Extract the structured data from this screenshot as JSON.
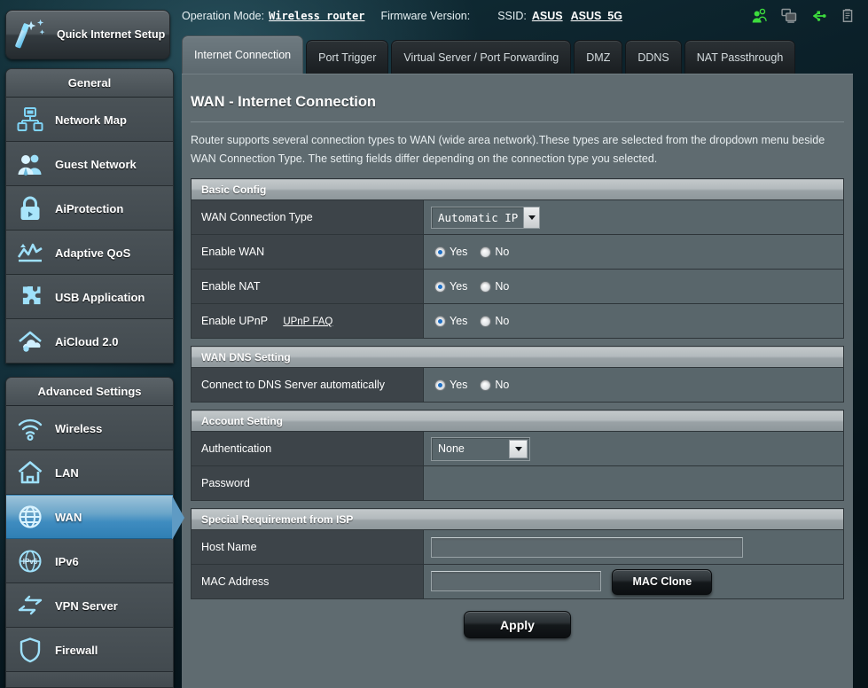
{
  "topbar": {
    "operation_mode_label": "Operation Mode:",
    "operation_mode_value": "Wireless router",
    "firmware_label": "Firmware Version:",
    "firmware_value": "",
    "ssid_label": "SSID:",
    "ssid_1": "ASUS",
    "ssid_2": "ASUS_5G",
    "icons": [
      {
        "name": "clients-icon",
        "color": "#3ddc3d"
      },
      {
        "name": "devices-icon",
        "color": "#8d9598"
      },
      {
        "name": "usb-icon",
        "color": "#3ddc3d"
      },
      {
        "name": "printer-icon",
        "color": "#8d9598"
      }
    ]
  },
  "sidebar": {
    "quick_setup": {
      "label": "Quick Internet Setup",
      "icon": "magic-wand-icon"
    },
    "general": {
      "header": "General",
      "items": [
        {
          "label": "Network Map",
          "icon": "network-map-icon"
        },
        {
          "label": "Guest Network",
          "icon": "guest-network-icon"
        },
        {
          "label": "AiProtection",
          "icon": "lock-icon"
        },
        {
          "label": "Adaptive QoS",
          "icon": "qos-chart-icon"
        },
        {
          "label": "USB Application",
          "icon": "puzzle-icon"
        },
        {
          "label": "AiCloud 2.0",
          "icon": "cloud-house-icon"
        }
      ]
    },
    "advanced": {
      "header": "Advanced Settings",
      "items": [
        {
          "label": "Wireless",
          "icon": "wifi-icon",
          "active": false
        },
        {
          "label": "LAN",
          "icon": "house-icon",
          "active": false
        },
        {
          "label": "WAN",
          "icon": "globe-icon",
          "active": true
        },
        {
          "label": "IPv6",
          "icon": "ipv6-icon",
          "active": false
        },
        {
          "label": "VPN Server",
          "icon": "vpn-icon",
          "active": false
        },
        {
          "label": "Firewall",
          "icon": "shield-icon",
          "active": false
        }
      ]
    }
  },
  "tabs": [
    {
      "label": "Internet Connection",
      "active": true
    },
    {
      "label": "Port Trigger",
      "active": false
    },
    {
      "label": "Virtual Server / Port Forwarding",
      "active": false
    },
    {
      "label": "DMZ",
      "active": false
    },
    {
      "label": "DDNS",
      "active": false
    },
    {
      "label": "NAT Passthrough",
      "active": false
    }
  ],
  "page": {
    "title": "WAN - Internet Connection",
    "description": "Router supports several connection types to WAN (wide area network).These types are selected from the dropdown menu beside WAN Connection Type. The setting fields differ depending on the connection type you selected."
  },
  "basic_config": {
    "header": "Basic Config",
    "wan_connection_type": {
      "label": "WAN Connection Type",
      "value": "Automatic IP"
    },
    "enable_wan": {
      "label": "Enable WAN",
      "yes": "Yes",
      "no": "No",
      "selected": "Yes"
    },
    "enable_nat": {
      "label": "Enable NAT",
      "yes": "Yes",
      "no": "No",
      "selected": "Yes"
    },
    "enable_upnp": {
      "label": "Enable UPnP",
      "faq_link": "UPnP FAQ",
      "yes": "Yes",
      "no": "No",
      "selected": "Yes"
    }
  },
  "wan_dns": {
    "header": "WAN DNS Setting",
    "connect_auto": {
      "label": "Connect to DNS Server automatically",
      "yes": "Yes",
      "no": "No",
      "selected": "Yes"
    }
  },
  "account_setting": {
    "header": "Account Setting",
    "authentication": {
      "label": "Authentication",
      "value": "None"
    },
    "password": {
      "label": "Password",
      "value": ""
    }
  },
  "isp": {
    "header": "Special Requirement from ISP",
    "host_name": {
      "label": "Host Name",
      "value": ""
    },
    "mac_address": {
      "label": "MAC Address",
      "value": "",
      "clone_button": "MAC Clone"
    }
  },
  "actions": {
    "apply": "Apply"
  },
  "colors": {
    "accent_blue": "#3f8cc0",
    "panel_bg": "#5f6b70",
    "row_label_bg": "#3d4449",
    "row_value_bg": "#59666b",
    "status_green": "#3ddc3d"
  }
}
